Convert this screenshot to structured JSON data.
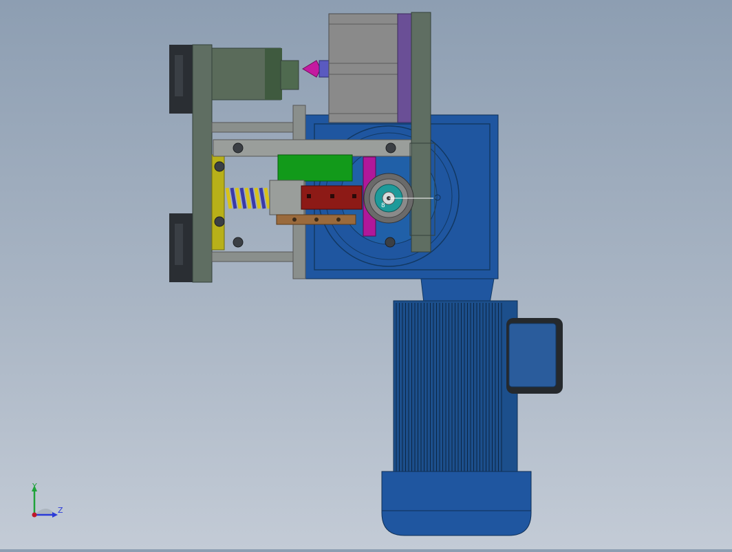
{
  "view": {
    "name": "cad-assembly-viewport",
    "background": [
      "#8d9eb2",
      "#c3cbd6"
    ]
  },
  "triad": {
    "y_label": "Y",
    "z_label": "Z",
    "y_color": "#1fa33a",
    "z_color": "#2a3ad8",
    "origin_color": "#c0182a"
  },
  "model": {
    "marker_label": "8",
    "colors": {
      "motor_blue": "#1c4f8c",
      "gearbox_blue": "#1f56a0",
      "frame_gray": "#5f6e62",
      "cylinder_gray": "#8a8a8a",
      "cylinder_purple": "#6a4f96",
      "green_block": "#129a1a",
      "yellow_plate": "#b8b019",
      "spring_yellow": "#d8c21a",
      "spring_blue": "#3a3aa8",
      "red_block": "#8d1a16",
      "brown_bar": "#9a6a3c",
      "magenta_bar": "#b0189a",
      "cyan_bearing": "#1e9a9a",
      "dark_bracket": "#2a2e33"
    }
  }
}
